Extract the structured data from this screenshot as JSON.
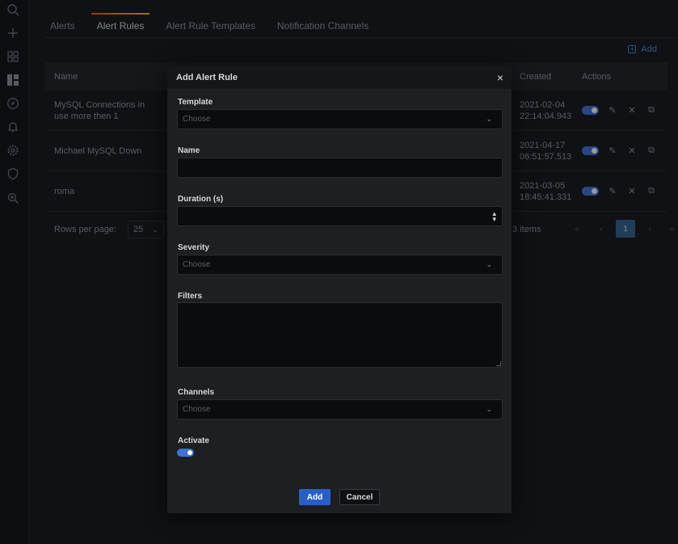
{
  "tabs": [
    {
      "label": "Alerts"
    },
    {
      "label": "Alert Rules"
    },
    {
      "label": "Alert Rule Templates"
    },
    {
      "label": "Notification Channels"
    }
  ],
  "toolbar": {
    "add_label": "Add"
  },
  "table": {
    "headers": {
      "name": "Name",
      "created": "Created",
      "actions": "Actions"
    },
    "rows": [
      {
        "name": "MySQL Connections in use more then 1",
        "created": "2021-02-04 22:14:04.943"
      },
      {
        "name": "Michael MySQL Down",
        "created": "2021-04-17 06:51:57.513"
      },
      {
        "name": "roma",
        "created": "2021-03-05 18:45:41.331"
      }
    ]
  },
  "pagination": {
    "rows_label": "Rows per page:",
    "rows_value": "25",
    "items_label": "3 items",
    "first": "«",
    "prev": "‹",
    "current": "1",
    "next": "›",
    "last": "»"
  },
  "modal": {
    "title": "Add Alert Rule",
    "close": "×",
    "template_label": "Template",
    "template_placeholder": "Choose",
    "name_label": "Name",
    "duration_label": "Duration (s)",
    "severity_label": "Severity",
    "severity_placeholder": "Choose",
    "filters_label": "Filters",
    "channels_label": "Channels",
    "channels_placeholder": "Choose",
    "activate_label": "Activate",
    "add_button": "Add",
    "cancel_button": "Cancel"
  },
  "colors": {
    "accent": "#3d72d7",
    "primary_button": "#2a5ec7",
    "link": "#3d8ce0",
    "tab_gradient_start": "#f05a28",
    "tab_gradient_end": "#fbca0a"
  },
  "icons": {
    "sidebar": [
      "search-icon",
      "plus-icon",
      "dashboards-icon",
      "panels-icon",
      "explore-icon",
      "bell-icon",
      "gear-icon",
      "shield-icon",
      "zoom-icon"
    ],
    "row_actions": [
      "toggle",
      "pencil-icon",
      "close-icon",
      "copy-icon"
    ]
  }
}
